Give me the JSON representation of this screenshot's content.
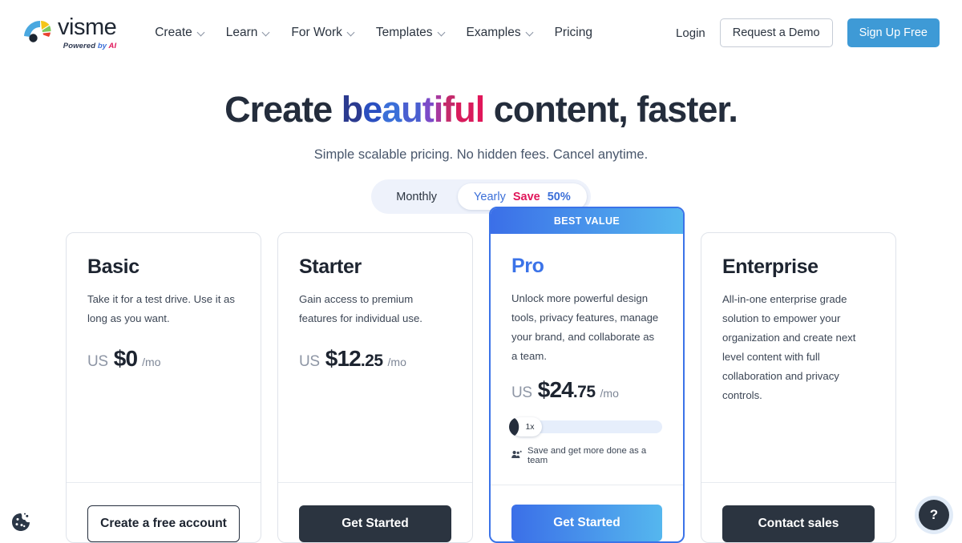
{
  "header": {
    "logo": {
      "word": "visme",
      "tagline_powered": "Powered",
      "tagline_by": "by",
      "tagline_ai": "AI"
    },
    "nav": [
      {
        "label": "Create",
        "has_caret": true
      },
      {
        "label": "Learn",
        "has_caret": true
      },
      {
        "label": "For Work",
        "has_caret": true
      },
      {
        "label": "Templates",
        "has_caret": true
      },
      {
        "label": "Examples",
        "has_caret": true
      },
      {
        "label": "Pricing",
        "has_caret": false
      }
    ],
    "login_label": "Login",
    "demo_label": "Request a Demo",
    "signup_label": "Sign Up Free",
    "signup_color": "#3e9ad6"
  },
  "hero": {
    "headline_pre": "Create ",
    "headline_accent": [
      "b",
      "e",
      "a",
      "u",
      "t",
      "i",
      "f",
      "u",
      "l"
    ],
    "headline_post": " content, faster.",
    "subhead": "Simple scalable pricing. No hidden fees. Cancel anytime."
  },
  "billing_toggle": {
    "monthly_label": "Monthly",
    "yearly_label": "Yearly",
    "save_label": "Save",
    "save_percent": "50%",
    "selected": "Yearly"
  },
  "plans": [
    {
      "name": "Basic",
      "description": "Take it for a test drive. Use it as long as you want.",
      "currency": "US",
      "price_main": "$0",
      "price_cents": "",
      "period": "/mo",
      "cta": "Create a free account",
      "badge": "",
      "featured": false
    },
    {
      "name": "Starter",
      "description": "Gain access to premium features for individual use.",
      "currency": "US",
      "price_main": "$12",
      "price_cents": ".25",
      "period": "/mo",
      "cta": "Get Started",
      "badge": "",
      "featured": false
    },
    {
      "name": "Pro",
      "description": "Unlock more powerful design tools, privacy features, manage your brand, and collaborate as a team.",
      "currency": "US",
      "price_main": "$24",
      "price_cents": ".75",
      "period": "/mo",
      "cta": "Get Started",
      "badge": "BEST VALUE",
      "featured": true,
      "seat_slider": {
        "value": "1x",
        "note": "Save and get more done as a team"
      }
    },
    {
      "name": "Enterprise",
      "description": "All-in-one enterprise grade solution to empower your organization and create next level content with full collaboration and privacy controls.",
      "currency": "",
      "price_main": "",
      "price_cents": "",
      "period": "",
      "cta": "Contact sales",
      "badge": "",
      "featured": false
    }
  ],
  "floating": {
    "cookie_icon": "cookie-icon",
    "help_label": "?"
  },
  "colors": {
    "brand_blue": "#3b73e8",
    "accent_pink": "#e0175a",
    "dark": "#2b3440",
    "signup_blue": "#3e9ad6"
  }
}
